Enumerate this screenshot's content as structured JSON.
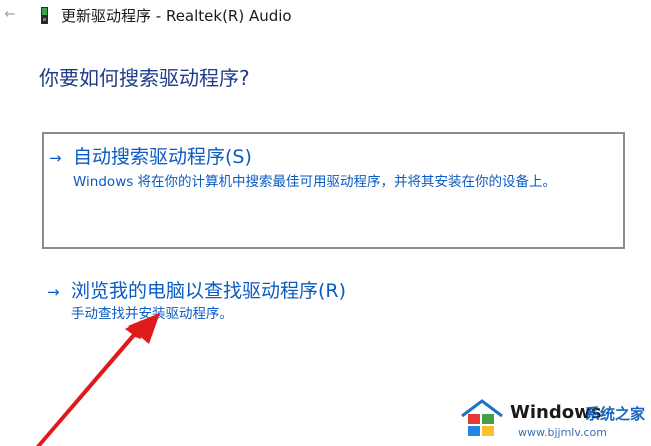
{
  "window": {
    "title": "更新驱动程序 - Realtek(R) Audio",
    "back_icon": "back-arrow-icon",
    "app_icon": "device-driver-icon"
  },
  "page": {
    "heading": "你要如何搜索驱动程序?"
  },
  "options": [
    {
      "arrow": "→",
      "title": "自动搜索驱动程序(S)",
      "description": "Windows 将在你的计算机中搜索最佳可用驱动程序，并将其安装在你的设备上。"
    },
    {
      "arrow": "→",
      "title": "浏览我的电脑以查找驱动程序(R)",
      "description": "手动查找并安装驱动程序。"
    }
  ],
  "annotation": {
    "type": "red-arrow",
    "color": "#e0191b"
  },
  "watermark": {
    "brand": "Windows",
    "brand_cn": "系统之家",
    "url": "www.bjjmlv.com"
  },
  "colors": {
    "accent": "#0a5bc4",
    "heading": "#1e3b8a",
    "annotation": "#e0191b"
  }
}
